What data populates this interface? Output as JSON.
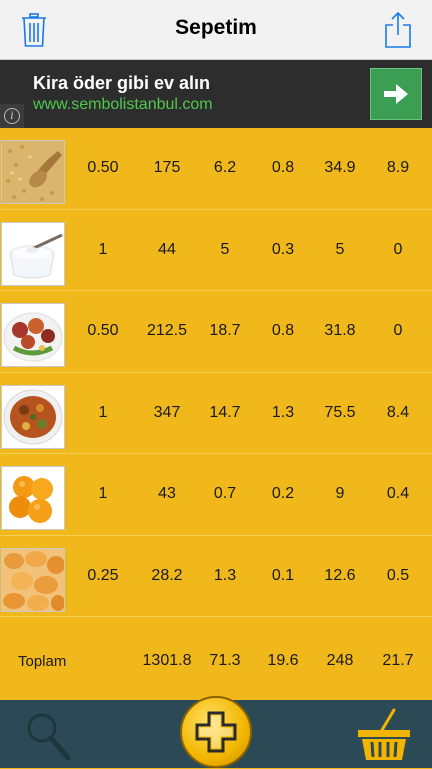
{
  "nav": {
    "title": "Sepetim",
    "left_icon": "trash-icon",
    "right_icon": "share-icon"
  },
  "ad": {
    "title": "Kira öder gibi ev alın",
    "url": "www.sembolistanbul.com",
    "info_glyph": "i"
  },
  "rows": [
    {
      "image": "bulgur-food-image",
      "values": [
        "0.50",
        "175",
        "6.2",
        "0.8",
        "34.9",
        "8.9"
      ]
    },
    {
      "image": "yogurt-food-image",
      "values": [
        "1",
        "44",
        "5",
        "0.3",
        "5",
        "0"
      ]
    },
    {
      "image": "meat-dish-food-image",
      "values": [
        "0.50",
        "212.5",
        "18.7",
        "0.8",
        "31.8",
        "0"
      ]
    },
    {
      "image": "vegetable-stew-food-image",
      "values": [
        "1",
        "347",
        "14.7",
        "1.3",
        "75.5",
        "8.4"
      ]
    },
    {
      "image": "orange-food-image",
      "values": [
        "1",
        "43",
        "0.7",
        "0.2",
        "9",
        "0.4"
      ]
    },
    {
      "image": "dried-apricot-food-image",
      "values": [
        "0.25",
        "28.2",
        "1.3",
        "0.1",
        "12.6",
        "0.5"
      ]
    }
  ],
  "total": {
    "label": "Toplam",
    "values": [
      "1301.8",
      "71.3",
      "19.6",
      "248",
      "21.7"
    ]
  },
  "tabbar": {
    "items": [
      "search-icon",
      "add-food-icon",
      "basket-icon"
    ]
  },
  "colors": {
    "background": "#f0b81b",
    "tabbar": "#2c4a55",
    "ad": "#2d2d2d",
    "ad_url": "#4ec94e",
    "ad_button": "#3b9e53",
    "ios_blue": "#1a7ae8"
  }
}
